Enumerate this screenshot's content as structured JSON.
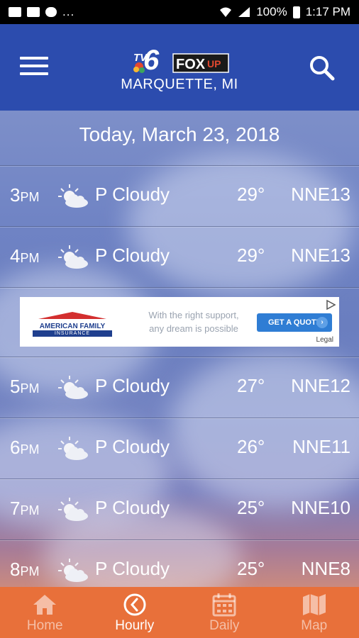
{
  "status_bar": {
    "dots": "...",
    "battery": "100%",
    "time": "1:17 PM"
  },
  "header": {
    "logo_tv": "TV",
    "logo_number": "6",
    "logo_fox": "FOX",
    "logo_up": "UP",
    "location": "MARQUETTE, MI"
  },
  "date_title": "Today, March 23, 2018",
  "hours": [
    {
      "hour": "3",
      "ampm": "PM",
      "condition": "P Cloudy",
      "temp": "29°",
      "wind": "NNE13"
    },
    {
      "hour": "4",
      "ampm": "PM",
      "condition": "P Cloudy",
      "temp": "29°",
      "wind": "NNE13"
    },
    {
      "hour": "5",
      "ampm": "PM",
      "condition": "P Cloudy",
      "temp": "27°",
      "wind": "NNE12"
    },
    {
      "hour": "6",
      "ampm": "PM",
      "condition": "P Cloudy",
      "temp": "26°",
      "wind": "NNE11"
    },
    {
      "hour": "7",
      "ampm": "PM",
      "condition": "P Cloudy",
      "temp": "25°",
      "wind": "NNE10"
    },
    {
      "hour": "8",
      "ampm": "PM",
      "condition": "P Cloudy",
      "temp": "25°",
      "wind": "NNE8"
    }
  ],
  "ad": {
    "brand_line1": "AMERICAN FAMILY",
    "brand_line2": "INSURANCE",
    "text_line1": "With the right support,",
    "text_line2": "any dream is possible",
    "cta": "GET A QUOTE",
    "legal": "Legal"
  },
  "nav": {
    "home": "Home",
    "hourly": "Hourly",
    "daily": "Daily",
    "map": "Map"
  },
  "colors": {
    "app_bar": "#2c4cae",
    "bottom_nav": "#e8703a",
    "ad_cta": "#2f7dd4"
  }
}
